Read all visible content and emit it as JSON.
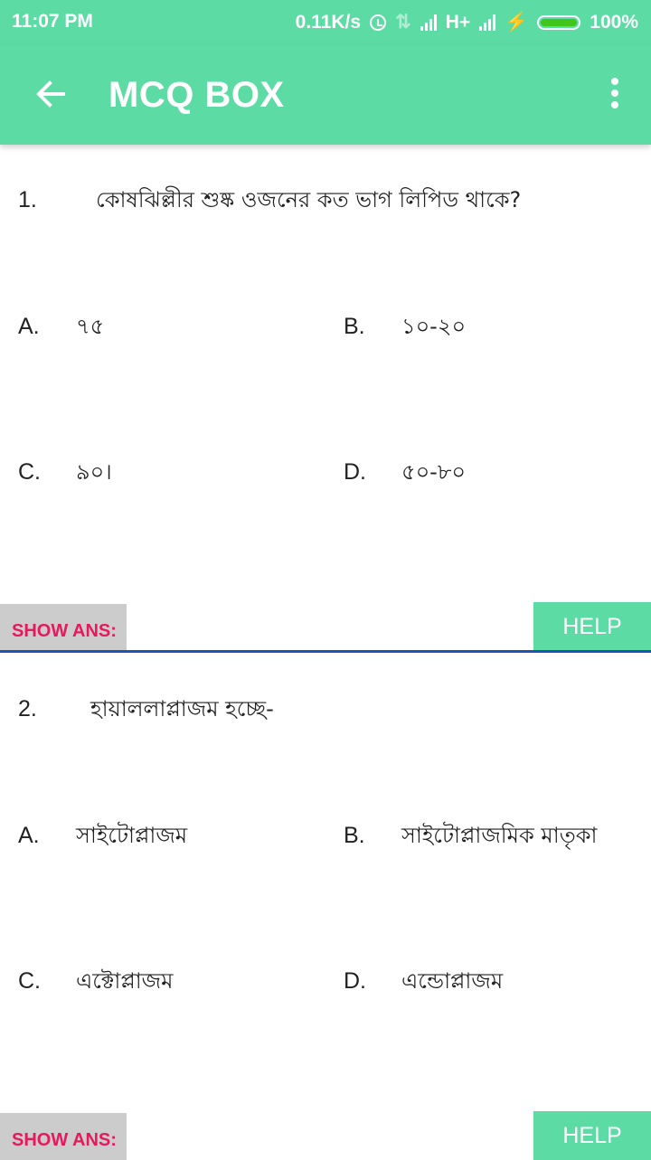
{
  "status_bar": {
    "time": "11:07 PM",
    "speed": "0.11K/s",
    "network": "H+",
    "battery": "100%"
  },
  "app_bar": {
    "title": "MCQ BOX"
  },
  "questions": [
    {
      "number": "1.",
      "text": "কোষঝিল্লীর শুষ্ক ওজনের কত ভাগ লিপিড থাকে?",
      "options": [
        {
          "label": "A.",
          "text": "৭৫"
        },
        {
          "label": "B.",
          "text": "১০-২০"
        },
        {
          "label": "C.",
          "text": "৯০।"
        },
        {
          "label": "D.",
          "text": "৫০-৮০"
        }
      ],
      "show_ans_label": "SHOW ANS:",
      "help_label": "HELP"
    },
    {
      "number": "2.",
      "text": "হায়াললাপ্লাজম হচ্ছে-",
      "options": [
        {
          "label": "A.",
          "text": "সাইটোপ্লাজম"
        },
        {
          "label": "B.",
          "text": "সাইটোপ্লাজমিক মাতৃকা"
        },
        {
          "label": "C.",
          "text": "এক্টোপ্লাজম"
        },
        {
          "label": "D.",
          "text": "এন্ডোপ্লাজম"
        }
      ],
      "show_ans_label": "SHOW ANS:",
      "help_label": "HELP"
    }
  ],
  "colors": {
    "accent": "#5cdba4",
    "show_ans_text": "#e5195c",
    "divider": "#1e54b3"
  }
}
